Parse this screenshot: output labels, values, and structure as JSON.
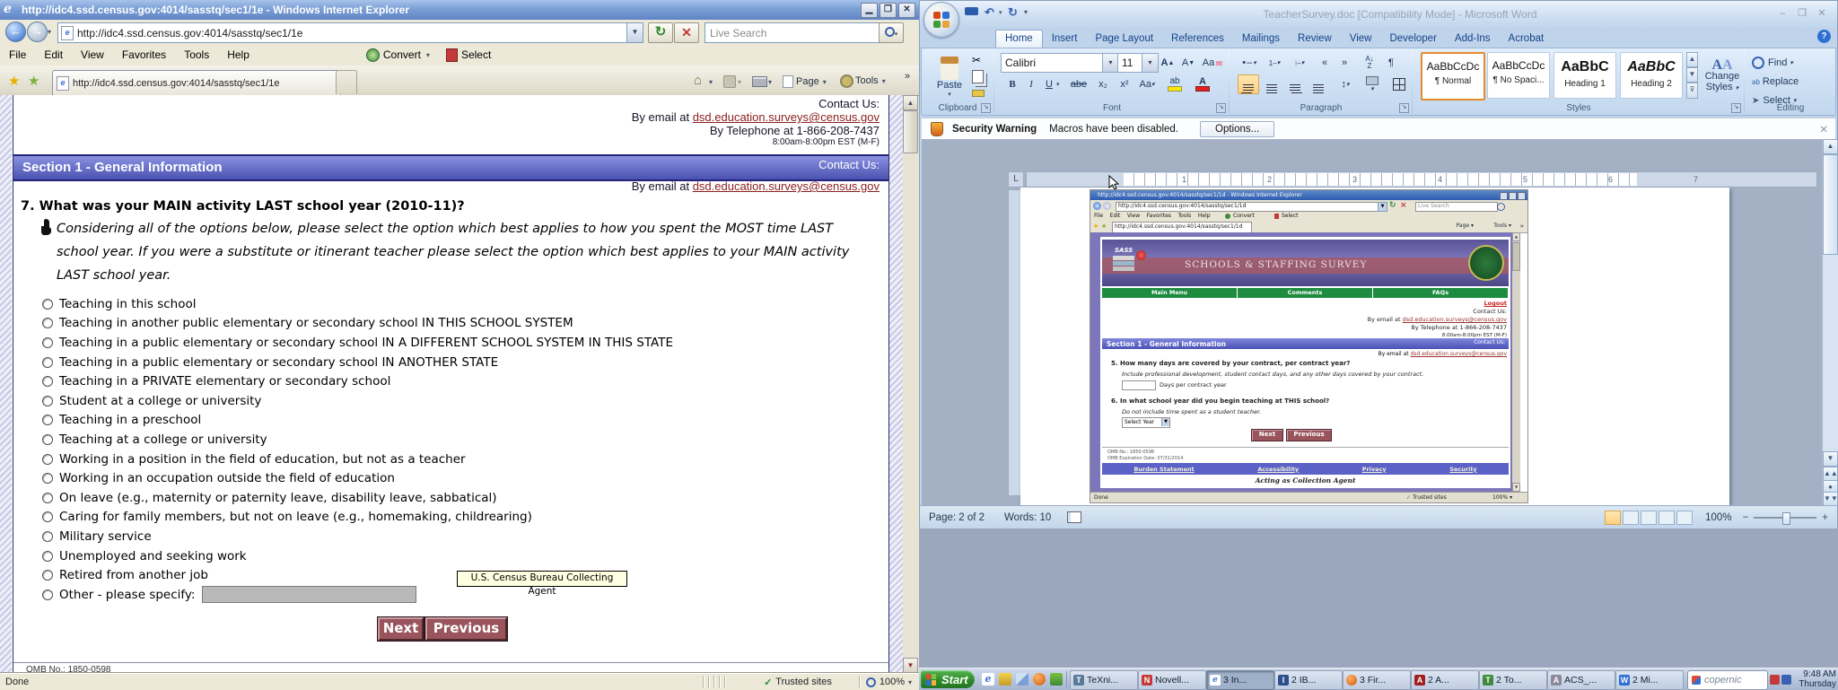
{
  "colors": {
    "section_bar_blue": "#4a52b4",
    "maroon_button": "#9a545c",
    "nav_green": "#1d8c3f",
    "link_red": "#8b2020",
    "xp_titlebar_blue": "#6f95cd",
    "start_green": "#2f8a2c"
  },
  "ie": {
    "window_title": "http://idc4.ssd.census.gov:4014/sasstq/sec1/1e - Windows Internet Explorer",
    "address_url": "http://idc4.ssd.census.gov:4014/sasstq/sec1/1e",
    "search_placeholder": "Live Search",
    "menu_items": [
      "File",
      "Edit",
      "View",
      "Favorites",
      "Tools",
      "Help"
    ],
    "convert_label": "Convert",
    "select_label": "Select",
    "tab_label": "http://idc4.ssd.census.gov:4014/sasstq/sec1/1e",
    "command_page": "Page",
    "command_tools": "Tools",
    "page": {
      "contact_heading": "Contact Us:",
      "email_prefix": "By email at ",
      "email_link": "dsd.education.surveys@census.gov",
      "phone_line": "By Telephone at 1-866-208-7437",
      "hours_line": "8:00am-8:00pm EST (M-F)",
      "section_title": "Section 1 - General Information",
      "section_contact": "Contact Us:",
      "question": "7. What was your MAIN activity LAST school year (2010-11)?",
      "instruction": "Considering all of the options below, please select the option which best applies to how you spent the MOST time LAST school year. If you were a substitute or itinerant teacher please select the option which best applies to your MAIN activity LAST school year.",
      "options": [
        "Teaching in this school",
        "Teaching in another public elementary or secondary school IN THIS SCHOOL SYSTEM",
        "Teaching in a public elementary or secondary school IN A DIFFERENT SCHOOL SYSTEM IN THIS STATE",
        "Teaching in a public elementary or secondary school IN ANOTHER STATE",
        "Teaching in a PRIVATE elementary or secondary school",
        "Student at a college or university",
        "Teaching in a preschool",
        "Teaching at a college or university",
        "Working in a position in the field of education, but not as a teacher",
        "Working in an occupation outside the field of education",
        "On leave (e.g., maternity or paternity leave, disability leave, sabbatical)",
        "Caring for family members, but not on leave (e.g., homemaking, childrearing)",
        "Military service",
        "Unemployed and seeking work",
        "Retired from another job"
      ],
      "other_option": "Other - please specify:",
      "tooltip": "U.S. Census Bureau Collecting Agent",
      "next_label": "Next",
      "previous_label": "Previous",
      "omb_line": "OMB No.: 1850-0598"
    },
    "status_done": "Done",
    "status_trusted": "Trusted sites",
    "status_zoom": "100%"
  },
  "word": {
    "window_title": "TeacherSurvey.doc [Compatibility Mode] - Microsoft Word",
    "ribbon_tabs": [
      "Home",
      "Insert",
      "Page Layout",
      "References",
      "Mailings",
      "Review",
      "View",
      "Developer",
      "Add-Ins",
      "Acrobat"
    ],
    "paste_label": "Paste",
    "font_name": "Calibri",
    "font_size": "11",
    "bold_label": "B",
    "italic_label": "I",
    "underline_label": "U",
    "strike_label": "abe",
    "subscript_label": "x₂",
    "superscript_label": "x²",
    "case_label": "Aa",
    "clear_label": "Aa",
    "sort_a": "A",
    "sort_z": "Z",
    "paragraph_mark": "¶",
    "group_labels": {
      "clipboard": "Clipboard",
      "font": "Font",
      "paragraph": "Paragraph",
      "styles": "Styles",
      "editing": "Editing"
    },
    "styles": [
      {
        "preview": "AaBbCcDc",
        "label": "¶ Normal"
      },
      {
        "preview": "AaBbCcDc",
        "label": "¶ No Spaci..."
      },
      {
        "preview": "AaBbC",
        "label": "Heading 1"
      },
      {
        "preview": "AaBbC",
        "label": "Heading 2"
      }
    ],
    "change_styles_line1": "Change",
    "change_styles_line2": "Styles",
    "find_label": "Find",
    "replace_label": "Replace",
    "select_label": "Select",
    "security_title": "Security Warning",
    "security_message": "Macros have been disabled.",
    "security_button": "Options...",
    "tab_selector": "L",
    "ruler_numbers": [
      "1",
      "2",
      "3",
      "4",
      "5",
      "6",
      "7"
    ],
    "status_page": "Page: 2 of 2",
    "status_words": "Words: 10",
    "status_zoom": "100%"
  },
  "doc_image": {
    "ie_title": "http://idc4.ssd.census.gov:4014/sasstq/sec1/1d - Windows Internet Explorer",
    "url": "http://idc4.ssd.census.gov:4014/sasstq/sec1/1d",
    "search_placeholder": "Live Search",
    "menu_line": "File    Edit    View    Favorites    Tools    Help",
    "convert_label": "Convert",
    "select_label": "Select",
    "tab_label": "http://idc4.ssd.census.gov:4014/sasstq/sec1/1d",
    "command_page": "Page",
    "command_tools": "Tools",
    "sass_label": "SASS",
    "banner_title": "SCHOOLS & STAFFING SURVEY",
    "nav_items": [
      "Main Menu",
      "Comments",
      "FAQs"
    ],
    "logout_label": "Logout",
    "contact_heading": "Contact Us:",
    "email_prefix": "By email at ",
    "email_link": "dsd.education.surveys@census.gov",
    "phone_line": "By Telephone at 1-866-208-7437",
    "hours_line": "8:00am-8:00pm EST (M-F)",
    "section_title": "Section 1 - General Information",
    "section_contact": "Contact Us:",
    "q5": "5. How many days are covered by your contract, per contract year?",
    "q5_note": "Include professional development, student contact days, and any other days covered by your contract.",
    "q5_field_label": "Days per contract year",
    "q6": "6. In what school year did you begin teaching at THIS school?",
    "q6_note": "Do not include time spent as a student teacher.",
    "select_year": "Select Year",
    "next_label": "Next",
    "previous_label": "Previous",
    "omb_line1": "OMB No.: 1850-0598",
    "omb_line2": "OMB Expiration Date: 07/31/2014",
    "footer_links": [
      "Burden Statement",
      "Accessibility",
      "Privacy",
      "Security"
    ],
    "acting_line": "Acting as Collection Agent",
    "status_done": "Done",
    "status_trusted": "Trusted sites",
    "status_zoom": "100%"
  },
  "taskbar": {
    "start_label": "Start",
    "buttons": [
      {
        "label": "TeXni..."
      },
      {
        "label": "Novell..."
      },
      {
        "label": "3 In...",
        "pressed": true
      },
      {
        "label": "2 IB..."
      },
      {
        "label": "3 Fir..."
      },
      {
        "label": "2 A..."
      },
      {
        "label": "2 To..."
      },
      {
        "label": "ACS_..."
      },
      {
        "label": "2 Mi..."
      }
    ],
    "search_label": "copernic",
    "clock_time": "9:48 AM",
    "clock_day": "Thursday"
  }
}
